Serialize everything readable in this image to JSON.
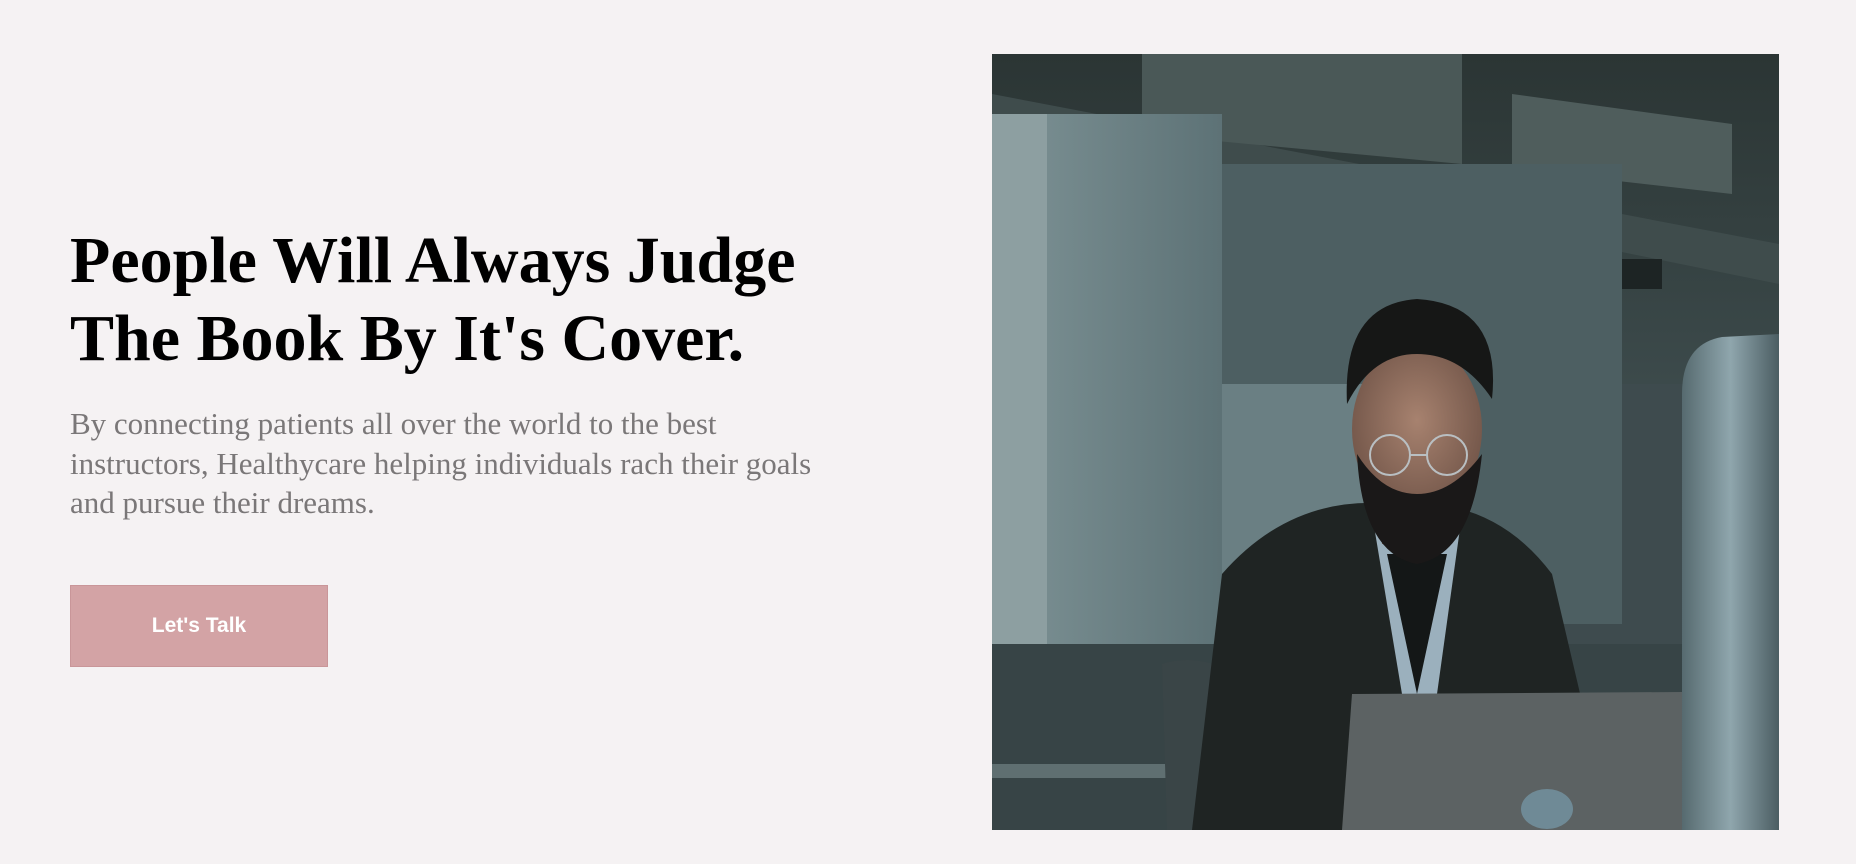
{
  "hero": {
    "headline": "People Will Always Judge The Book By It's Cover.",
    "subtext": "By connecting patients all over the world to the best instructors, Healthycare helping individuals rach their goals and pursue their dreams.",
    "cta_label": "Let's Talk"
  },
  "colors": {
    "background": "#f5f2f3",
    "headline": "#000000",
    "subtext": "#7a7778",
    "cta_background": "#d3a3a5",
    "cta_text": "#ffffff"
  },
  "image": {
    "subject": "man-with-glasses-working-on-laptop-photo"
  }
}
